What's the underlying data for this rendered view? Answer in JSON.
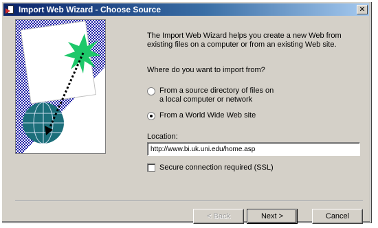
{
  "window": {
    "title": "Import Web Wizard - Choose Source",
    "close_glyph": "✕"
  },
  "intro_text": "The Import Web Wizard helps you create a new Web from existing files on a computer or from an existing Web site.",
  "question": "Where do you want to import from?",
  "options": [
    {
      "label": "From a source directory of files on a local computer or network",
      "selected": false
    },
    {
      "label": "From a World Wide Web site",
      "selected": true
    }
  ],
  "location": {
    "label": "Location:",
    "value": "http://www.bi.uk.uni.edu/home.asp"
  },
  "secure_checkbox": {
    "label": "Secure connection required (SSL)",
    "checked": false
  },
  "buttons": {
    "back": "< Back",
    "next": "Next >",
    "cancel": "Cancel"
  },
  "colors": {
    "title_start": "#0a246a",
    "title_end": "#a6caf0",
    "dialog_bg": "#d4d0c8",
    "checker": "#1a1aa6",
    "globe": "#1c6f7a",
    "burst": "#1ec86a"
  }
}
